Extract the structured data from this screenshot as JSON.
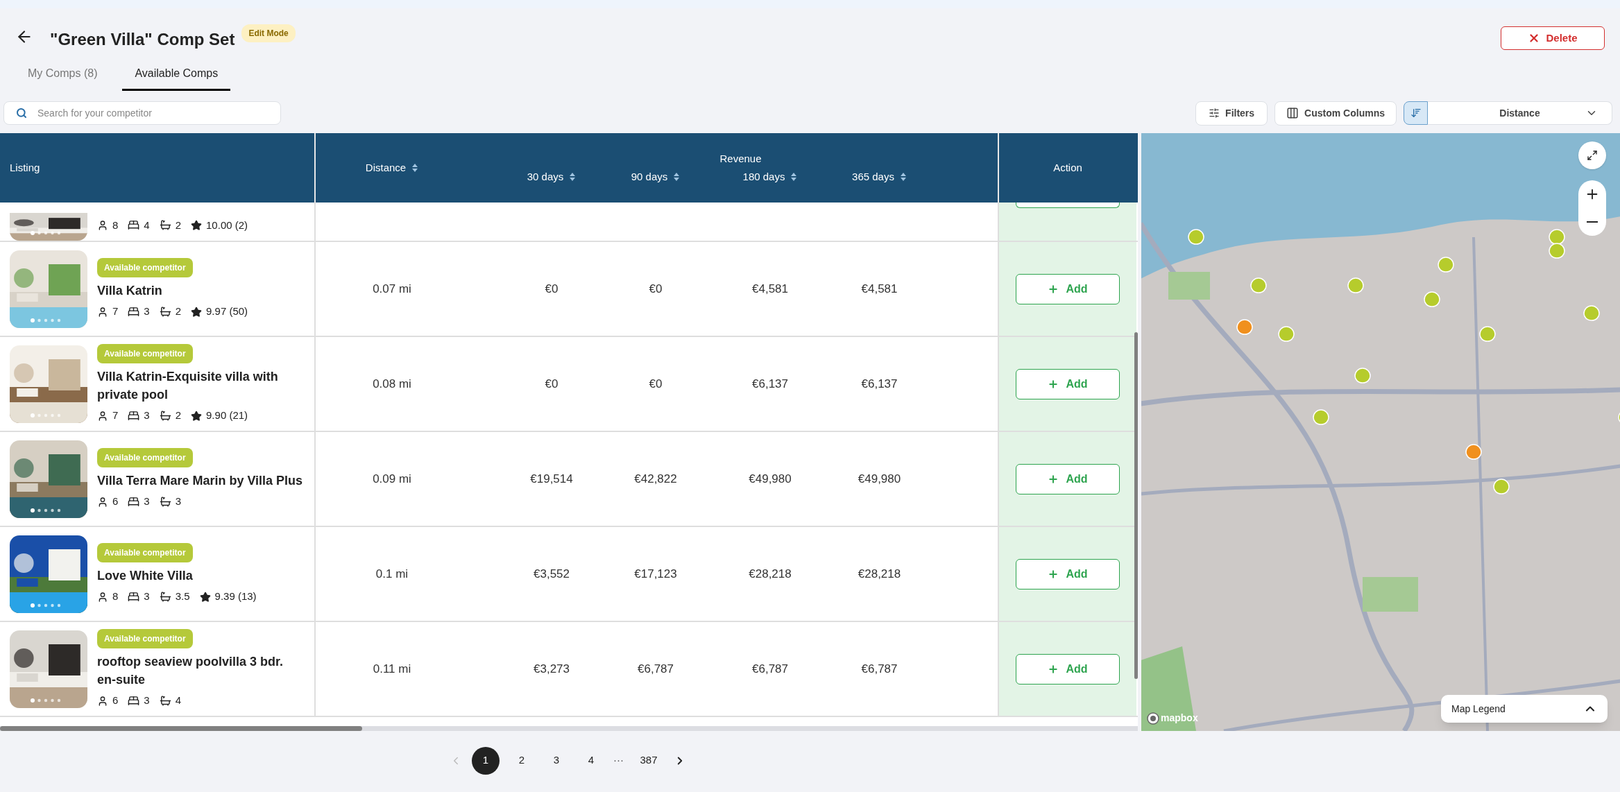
{
  "header": {
    "title": "\"Green Villa\" Comp Set",
    "badge": "Edit Mode",
    "delete_button": "Delete"
  },
  "tabs": [
    {
      "label": "My Comps (8)",
      "selected": false
    },
    {
      "label": "Available Comps",
      "selected": true
    }
  ],
  "search": {
    "placeholder": "Search for your competitor"
  },
  "toolbar": {
    "filters": "Filters",
    "custom_columns": "Custom Columns",
    "sort_value": "Distance"
  },
  "table": {
    "columns": {
      "listing": "Listing",
      "distance": "Distance",
      "revenue": "Revenue",
      "periods": [
        "30 days",
        "90 days",
        "180 days",
        "365 days"
      ],
      "action": "Action"
    },
    "partial_row": {
      "guests": "8",
      "bedrooms": "4",
      "bathrooms": "2",
      "rating": "10.00 (2)"
    },
    "rows": [
      {
        "badge": "Available competitor",
        "name": "Villa Katrin",
        "guests": "7",
        "bedrooms": "3",
        "bathrooms": "2",
        "rating": "9.97 (50)",
        "distance": "0.07 mi",
        "revenue": [
          "€0",
          "€0",
          "€4,581",
          "€4,581"
        ],
        "action": "Add"
      },
      {
        "badge": "Available competitor",
        "name": "Villa Katrin-Exquisite villa with private pool",
        "guests": "7",
        "bedrooms": "3",
        "bathrooms": "2",
        "rating": "9.90 (21)",
        "distance": "0.08 mi",
        "revenue": [
          "€0",
          "€0",
          "€6,137",
          "€6,137"
        ],
        "action": "Add"
      },
      {
        "badge": "Available competitor",
        "name": "Villa Terra Mare Marin by Villa Plus",
        "guests": "6",
        "bedrooms": "3",
        "bathrooms": "3",
        "distance": "0.09 mi",
        "revenue": [
          "€19,514",
          "€42,822",
          "€49,980",
          "€49,980"
        ],
        "action": "Add"
      },
      {
        "badge": "Available competitor",
        "name": "Love White Villa",
        "guests": "8",
        "bedrooms": "3",
        "bathrooms": "3.5",
        "rating": "9.39 (13)",
        "distance": "0.1 mi",
        "revenue": [
          "€3,552",
          "€17,123",
          "€28,218",
          "€28,218"
        ],
        "action": "Add"
      },
      {
        "badge": "Available competitor",
        "name": "rooftop seaview poolvilla 3 bdr. en-suite",
        "guests": "6",
        "bedrooms": "3",
        "bathrooms": "4",
        "distance": "0.11 mi",
        "revenue": [
          "€3,273",
          "€6,787",
          "€6,787",
          "€6,787"
        ],
        "action": "Add"
      }
    ]
  },
  "map": {
    "legend": "Map Legend",
    "attribution": "mapbox"
  },
  "pagination": {
    "previous": {
      "disabled": true
    },
    "pages": [
      {
        "label": "1",
        "selected": true
      },
      {
        "label": "2",
        "selected": false
      },
      {
        "label": "3",
        "selected": false
      },
      {
        "label": "4",
        "selected": false
      }
    ],
    "ellipsis": "···",
    "last": {
      "label": "387",
      "selected": false
    }
  }
}
